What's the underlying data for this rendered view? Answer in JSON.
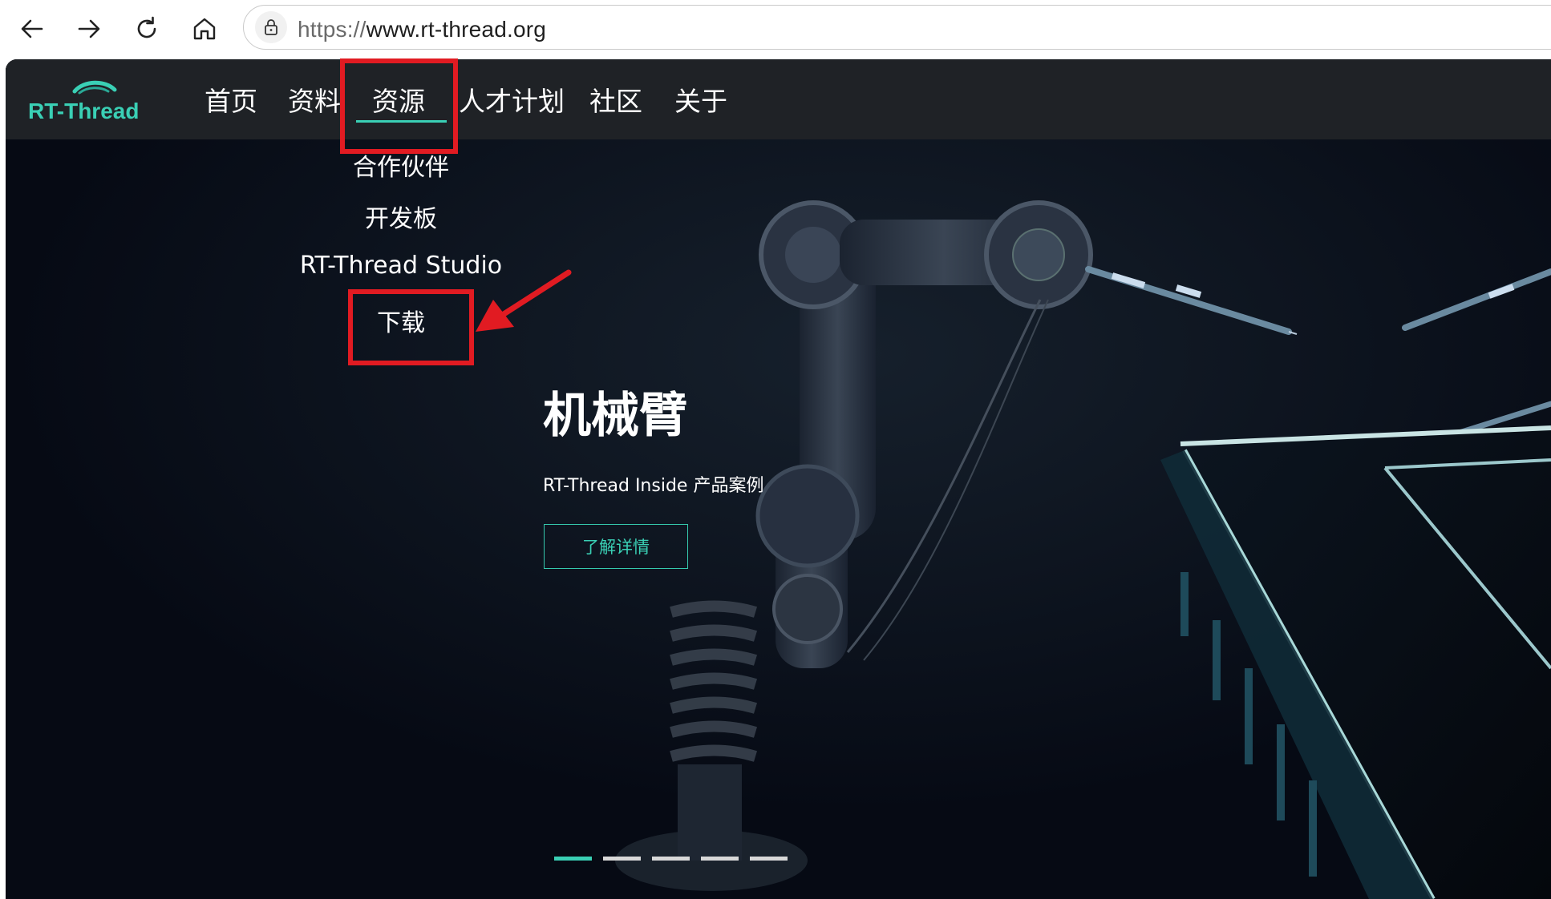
{
  "browser": {
    "url_scheme": "https://",
    "url_host": "www.rt-thread.org",
    "back_icon": "arrow-left-icon",
    "forward_icon": "arrow-right-icon",
    "reload_icon": "reload-icon",
    "home_icon": "home-icon",
    "security_icon": "lock-icon"
  },
  "site": {
    "logo_text": "RT-Thread",
    "nav": [
      {
        "label": "首页"
      },
      {
        "label": "资料"
      },
      {
        "label": "资源",
        "active": true
      },
      {
        "label": "人才计划"
      },
      {
        "label": "社区"
      },
      {
        "label": "关于"
      }
    ],
    "resources_menu": [
      {
        "label": "合作伙伴"
      },
      {
        "label": "开发板"
      },
      {
        "label": "RT-Thread Studio"
      },
      {
        "label": "下载"
      }
    ]
  },
  "hero": {
    "title": "机械臂",
    "subtitle": "RT-Thread Inside 产品案例",
    "cta_label": "了解详情",
    "slides_total": 5,
    "active_slide": 1
  },
  "colors": {
    "accent": "#3ad0b5",
    "header_bg": "#1f2226",
    "hero_bg": "#060a14",
    "annotation": "#e11b22"
  }
}
